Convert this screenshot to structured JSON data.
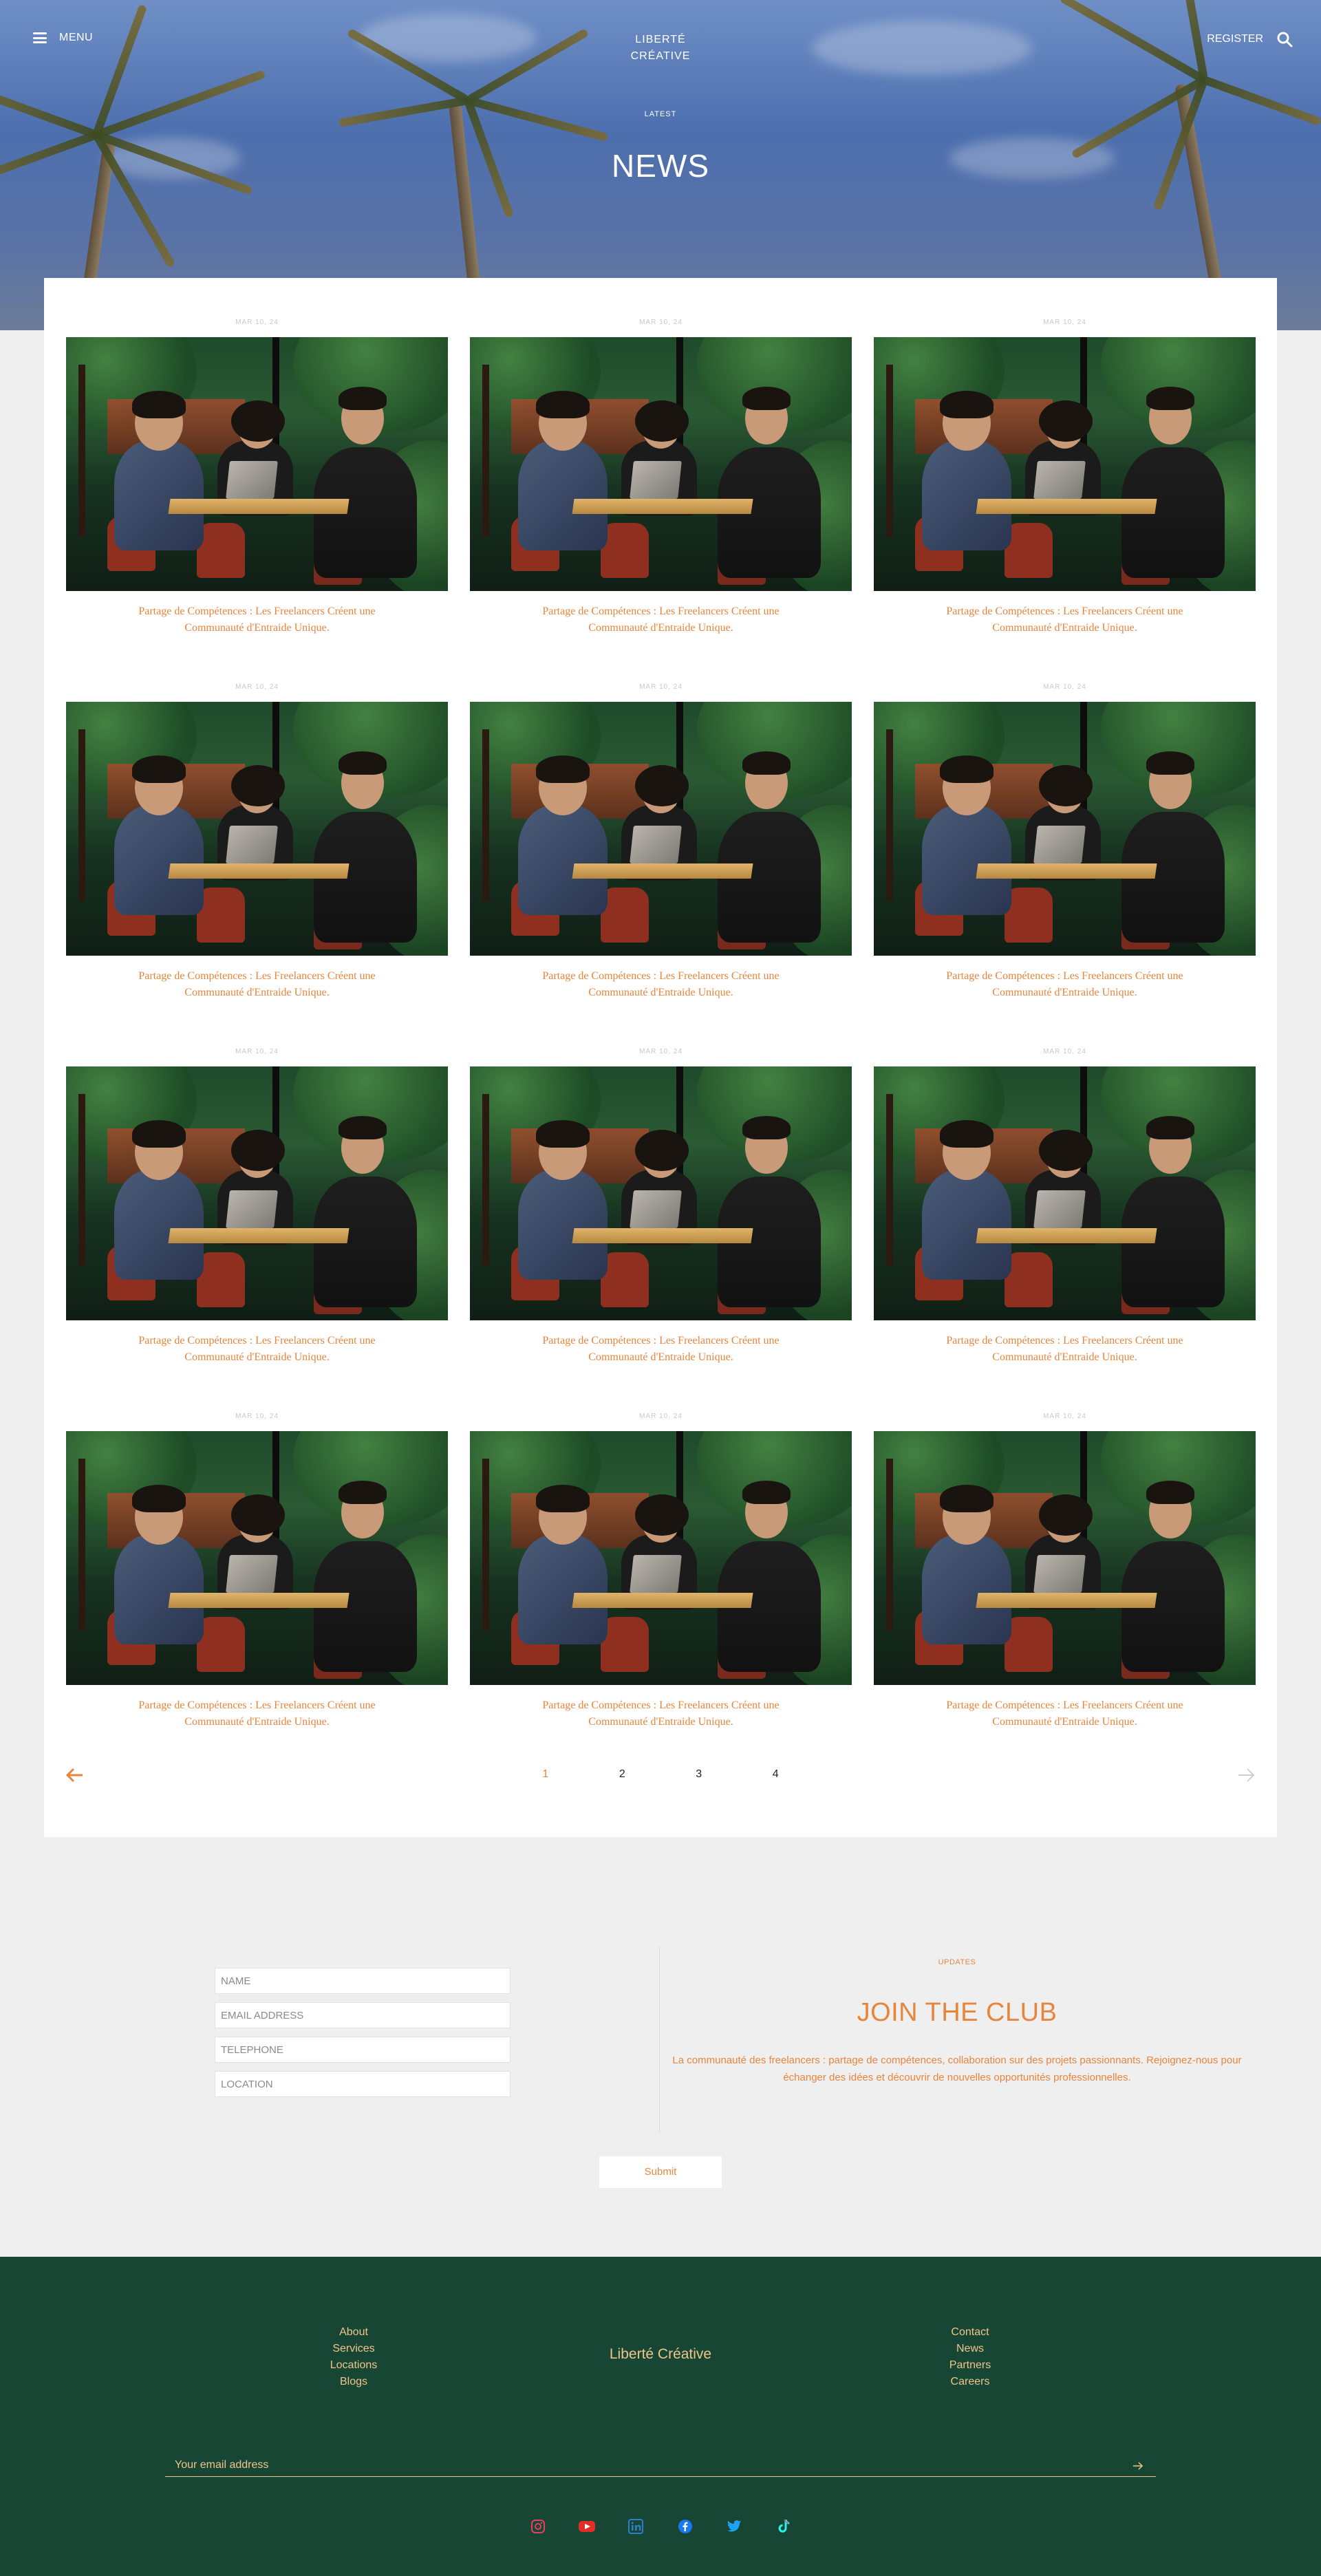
{
  "header": {
    "menu_label": "MENU",
    "brand_line1": "LIBERTÉ",
    "brand_line2": "CRÉATIVE",
    "register_label": "REGISTER"
  },
  "hero": {
    "kicker": "LATEST",
    "title": "NEWS"
  },
  "posts": [
    {
      "date": "MAR 10, 24",
      "title": "Partage de Compétences : Les Freelancers Créent une Communauté d'Entraide Unique."
    },
    {
      "date": "MAR 10, 24",
      "title": "Partage de Compétences : Les Freelancers Créent une Communauté d'Entraide Unique."
    },
    {
      "date": "MAR 10, 24",
      "title": "Partage de Compétences : Les Freelancers Créent une Communauté d'Entraide Unique."
    },
    {
      "date": "MAR 10, 24",
      "title": "Partage de Compétences : Les Freelancers Créent une Communauté d'Entraide Unique."
    },
    {
      "date": "MAR 10, 24",
      "title": "Partage de Compétences : Les Freelancers Créent une Communauté d'Entraide Unique."
    },
    {
      "date": "MAR 10, 24",
      "title": "Partage de Compétences : Les Freelancers Créent une Communauté d'Entraide Unique."
    },
    {
      "date": "MAR 10, 24",
      "title": "Partage de Compétences : Les Freelancers Créent une Communauté d'Entraide Unique."
    },
    {
      "date": "MAR 10, 24",
      "title": "Partage de Compétences : Les Freelancers Créent une Communauté d'Entraide Unique."
    },
    {
      "date": "MAR 10, 24",
      "title": "Partage de Compétences : Les Freelancers Créent une Communauté d'Entraide Unique."
    },
    {
      "date": "MAR 10, 24",
      "title": "Partage de Compétences : Les Freelancers Créent une Communauté d'Entraide Unique."
    },
    {
      "date": "MAR 10, 24",
      "title": "Partage de Compétences : Les Freelancers Créent une Communauté d'Entraide Unique."
    },
    {
      "date": "MAR 10, 24",
      "title": "Partage de Compétences : Les Freelancers Créent une Communauté d'Entraide Unique."
    }
  ],
  "pagination": {
    "pages": [
      "1",
      "2",
      "3",
      "4"
    ],
    "active_page": "1"
  },
  "join": {
    "form": {
      "name_placeholder": "NAME",
      "email_placeholder": "EMAIL ADDRESS",
      "telephone_placeholder": "TELEPHONE",
      "location_placeholder": "LOCATION"
    },
    "kicker": "UPDATES",
    "title": "JOIN THE CLUB",
    "text": "La communauté des freelancers : partage de compétences, collaboration sur des projets passionnants. Rejoignez-nous pour échanger des idées et découvrir de nouvelles opportunités professionnelles.",
    "submit_label": "Submit"
  },
  "footer": {
    "left_links": [
      "About",
      "Services",
      "Locations",
      "Blogs"
    ],
    "brand": "Liberté Créative",
    "right_links": [
      "Contact",
      "News",
      "Partners",
      "Careers"
    ],
    "newsletter_placeholder": "Your email address",
    "socials": [
      "instagram-icon",
      "youtube-icon",
      "linkedin-icon",
      "facebook-icon",
      "twitter-icon",
      "tiktok-icon"
    ]
  },
  "colors": {
    "accent": "#e8853c",
    "footer_bg": "#174634",
    "footer_text": "#f0c58a",
    "page_bg": "#efefef"
  }
}
